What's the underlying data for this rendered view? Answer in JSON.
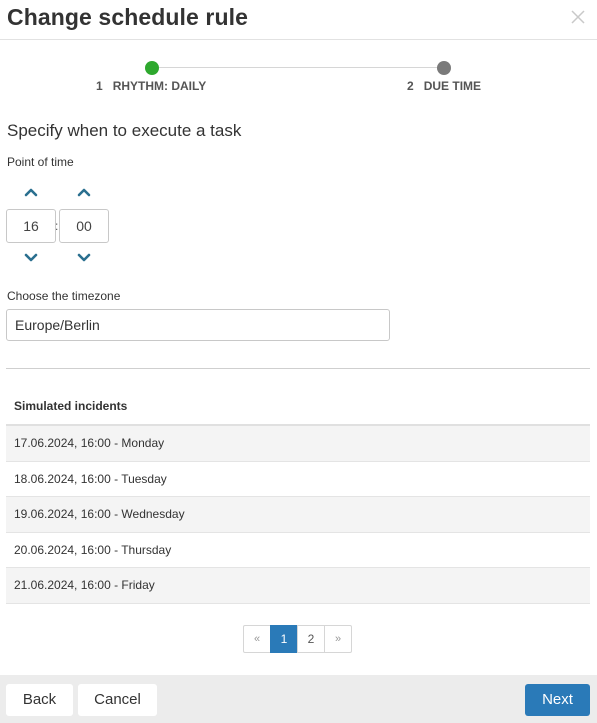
{
  "dialog": {
    "title": "Change schedule rule"
  },
  "wizard": {
    "steps": [
      {
        "number": "1",
        "label": "RHYTHM: DAILY",
        "status": "done",
        "color": "#2ea82e"
      },
      {
        "number": "2",
        "label": "DUE TIME",
        "status": "pending",
        "color": "#7a7a7a"
      }
    ]
  },
  "form": {
    "section_title": "Specify when to execute a task",
    "point_of_time_label": "Point of time",
    "hour": "16",
    "separator": ":",
    "minute": "00",
    "timezone_label": "Choose the timezone",
    "timezone": "Europe/Berlin"
  },
  "table": {
    "header": "Simulated incidents",
    "rows": [
      "17.06.2024, 16:00 - Monday",
      "18.06.2024, 16:00 - Tuesday",
      "19.06.2024, 16:00 - Wednesday",
      "20.06.2024, 16:00 - Thursday",
      "21.06.2024, 16:00 - Friday"
    ]
  },
  "pagination": {
    "prev": "«",
    "pages": [
      "1",
      "2"
    ],
    "next": "»",
    "active_page": "1"
  },
  "footer": {
    "back_label": "Back",
    "cancel_label": "Cancel",
    "next_label": "Next"
  },
  "colors": {
    "accent": "#2a7ab8",
    "success": "#2ea82e",
    "arrow": "#2a6f8f"
  },
  "icons": {
    "close": "close-icon",
    "up": "chevron-up-icon",
    "down": "chevron-down-icon"
  }
}
